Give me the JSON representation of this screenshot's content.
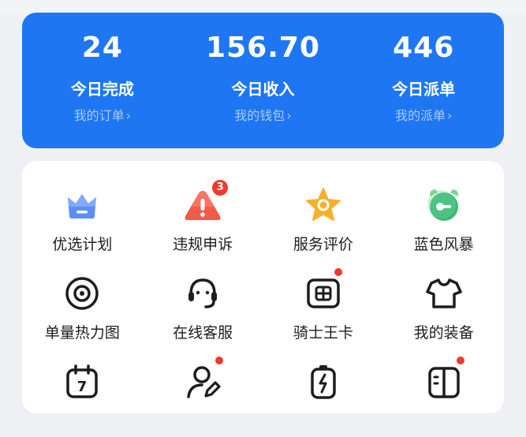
{
  "stats": [
    {
      "value": "24",
      "label": "今日完成",
      "link": "我的订单"
    },
    {
      "value": "156.70",
      "label": "今日收入",
      "link": "我的钱包"
    },
    {
      "value": "446",
      "label": "今日派单",
      "link": "我的派单"
    }
  ],
  "chevron": "›",
  "colors": {
    "primary": "#1e76f2",
    "badge": "#f03a2e",
    "panel": "#ffffff"
  },
  "menu": [
    {
      "label": "优选计划",
      "icon": "crown-icon"
    },
    {
      "label": "违规申诉",
      "icon": "warning-icon",
      "badge": "3"
    },
    {
      "label": "服务评价",
      "icon": "star-icon"
    },
    {
      "label": "蓝色风暴",
      "icon": "alarm-clock-icon"
    },
    {
      "label": "单量热力图",
      "icon": "target-icon"
    },
    {
      "label": "在线客服",
      "icon": "headset-icon"
    },
    {
      "label": "骑士王卡",
      "icon": "sim-card-icon",
      "dot": true
    },
    {
      "label": "我的装备",
      "icon": "shirt-icon"
    },
    {
      "label": "",
      "icon": "calendar-icon",
      "calendar_day": "7"
    },
    {
      "label": "",
      "icon": "user-edit-icon",
      "dot": true
    },
    {
      "label": "",
      "icon": "battery-icon"
    },
    {
      "label": "",
      "icon": "book-icon",
      "dot": true
    }
  ]
}
